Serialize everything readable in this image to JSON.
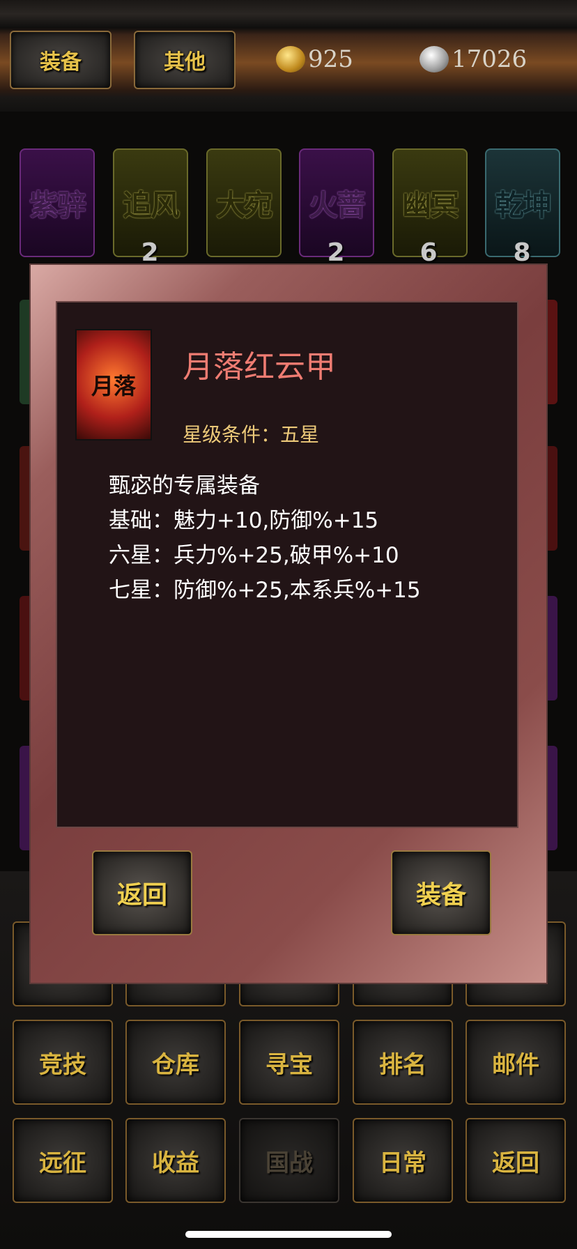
{
  "tabs": {
    "equip": "装备",
    "other": "其他"
  },
  "currency": {
    "gold": "925",
    "silver": "17026"
  },
  "horses": [
    {
      "name": "紫骍",
      "count": ""
    },
    {
      "name": "追风",
      "count": "2"
    },
    {
      "name": "大宛",
      "count": ""
    },
    {
      "name": "火蔷",
      "count": "2"
    },
    {
      "name": "幽冥",
      "count": "6"
    },
    {
      "name": "乾坤",
      "count": "8"
    }
  ],
  "dialog": {
    "icon_label": "月落",
    "item_name": "月落红云甲",
    "star_condition": "星级条件：五星",
    "desc_lines": [
      "甄宓的专属装备",
      "基础：魅力+10,防御%+15",
      "六星：兵力%+25,破甲%+10",
      "七星：防御%+25,本系兵%+15"
    ],
    "back": "返回",
    "equip": "装备"
  },
  "menu": {
    "row2": [
      "竞技",
      "仓库",
      "寻宝",
      "排名",
      "邮件"
    ],
    "row3": [
      "远征",
      "收益",
      "国战",
      "日常",
      "返回"
    ]
  },
  "colors": {
    "title": "#ef7c72",
    "condition": "#ecc979",
    "button_text": "#d9b440"
  }
}
